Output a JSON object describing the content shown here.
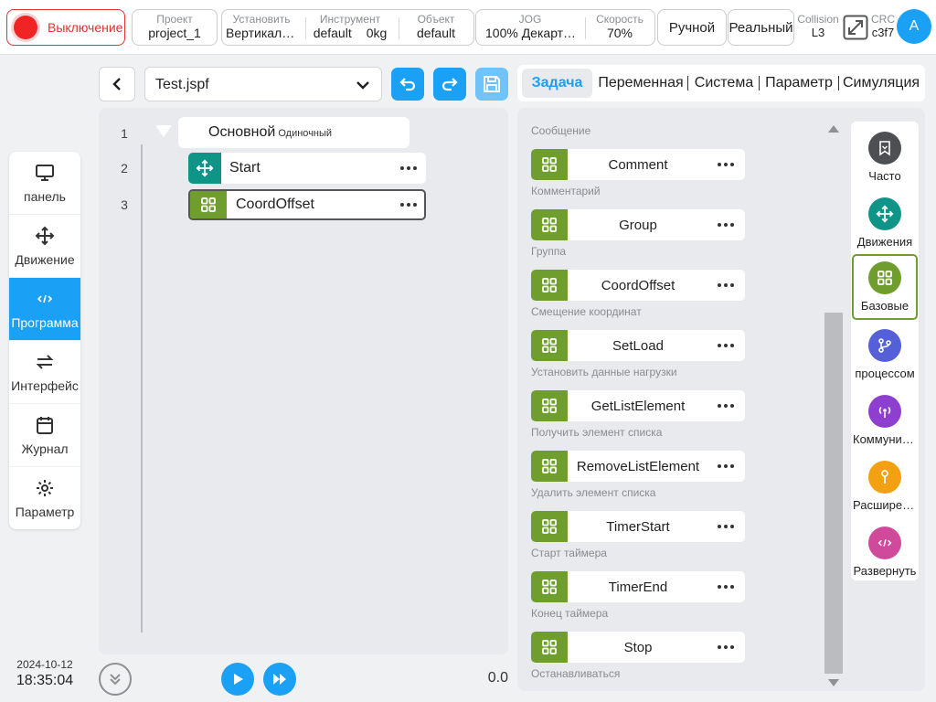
{
  "topbar": {
    "power_label": "Выключение",
    "project": {
      "label": "Проект",
      "value": "project_1"
    },
    "install": {
      "label": "Установить",
      "value": "Вертикальный"
    },
    "tool": {
      "label": "Инструмент",
      "value": "default",
      "extra": "0kg"
    },
    "object": {
      "label": "Объект",
      "value": "default"
    },
    "jog": {
      "label": "JOG",
      "value": "100%",
      "extra": "Декартова"
    },
    "speed": {
      "label": "Скорость",
      "value": "70%"
    },
    "mode_button": "Ручной",
    "real_button": "Реальный",
    "collision": {
      "label": "Collision",
      "value": "L3"
    },
    "crc": {
      "label": "CRC",
      "value": "c3f7"
    },
    "avatar_letter": "A"
  },
  "leftnav": {
    "items": [
      {
        "label": "панель",
        "icon": "monitor-icon"
      },
      {
        "label": "Движение",
        "icon": "move-icon"
      },
      {
        "label": "Программа",
        "icon": "code-icon"
      },
      {
        "label": "Интерфейс",
        "icon": "swap-icon"
      },
      {
        "label": "Журнал",
        "icon": "calendar-icon"
      },
      {
        "label": "Параметр",
        "icon": "gear-icon"
      }
    ],
    "active_index": 2
  },
  "datetime": {
    "date": "2024-10-12",
    "time": "18:35:04"
  },
  "editor": {
    "file_name": "Test.jspf",
    "lines": [
      "1",
      "2",
      "3"
    ],
    "main_block": {
      "label": "Основной",
      "sub": "Одиночный"
    },
    "commands": [
      {
        "label": "Start",
        "icon": "move-icon"
      },
      {
        "label": "CoordOffset",
        "icon": "grid-icon"
      }
    ],
    "progress_value": "0.0"
  },
  "tabs": [
    "Задача",
    "Переменная",
    "Система",
    "Параметр",
    "Симуляция"
  ],
  "palette": {
    "section_title": "Сообщение",
    "items": [
      {
        "label": "Comment",
        "desc": "Комментарий"
      },
      {
        "label": "Group",
        "desc": "Группа"
      },
      {
        "label": "CoordOffset",
        "desc": "Смещение координат"
      },
      {
        "label": "SetLoad",
        "desc": "Установить данные нагрузки"
      },
      {
        "label": "GetListElement",
        "desc": "Получить элемент списка"
      },
      {
        "label": "RemoveListElement",
        "desc": "Удалить элемент списка"
      },
      {
        "label": "TimerStart",
        "desc": "Старт таймера"
      },
      {
        "label": "TimerEnd",
        "desc": "Конец таймера"
      },
      {
        "label": "Stop",
        "desc": "Останавливаться"
      }
    ]
  },
  "categories": [
    {
      "label": "Часто",
      "color": "#4d4f53",
      "icon": "bookmark-icon"
    },
    {
      "label": "Движения",
      "color": "#0f9488",
      "icon": "move-icon"
    },
    {
      "label": "Базовые",
      "color": "#6f9e2e",
      "icon": "grid-icon"
    },
    {
      "label": "процессом",
      "color": "#5560d8",
      "icon": "branch-icon"
    },
    {
      "label": "Коммуникация",
      "color": "#8f3fd0",
      "icon": "antenna-icon"
    },
    {
      "label": "Расширение",
      "color": "#f3a012",
      "icon": "wrench-icon"
    },
    {
      "label": "Развернуть",
      "color": "#d04a9c",
      "icon": "code-icon"
    }
  ],
  "colors": {
    "accent": "#1aa0f5",
    "basic_green": "#6f9e2e",
    "motion_teal": "#0f9488",
    "danger": "#e03030"
  }
}
